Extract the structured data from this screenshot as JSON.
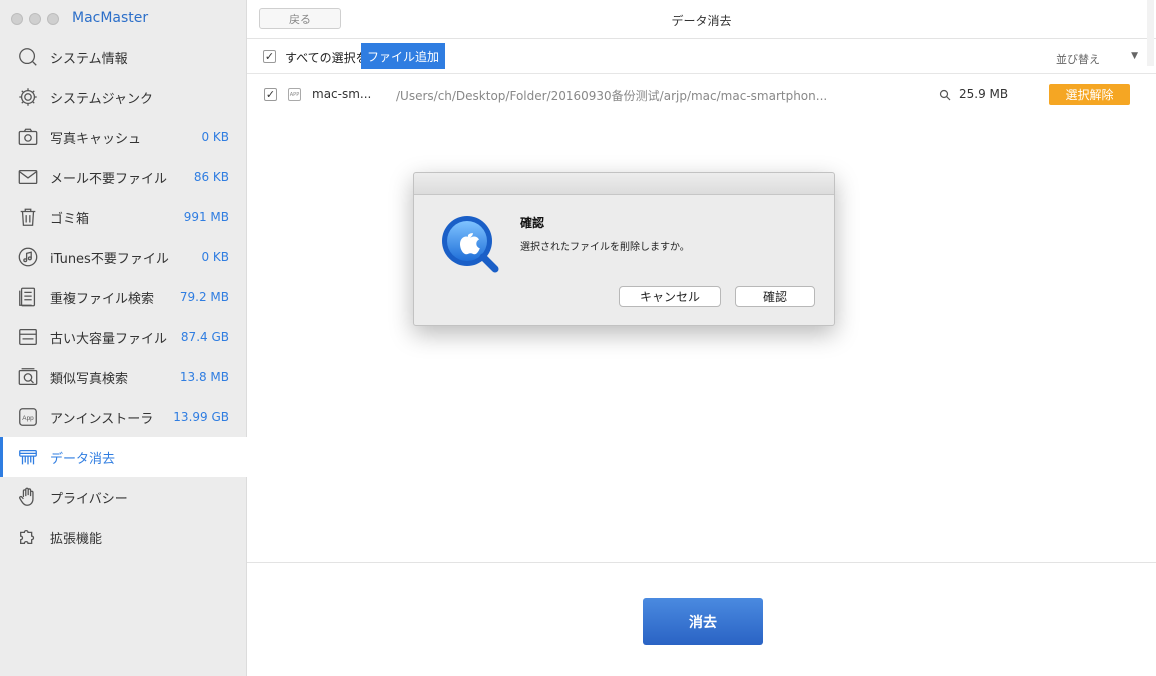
{
  "app": {
    "title": "MacMaster"
  },
  "sidebar": {
    "items": [
      {
        "label": "システム情報",
        "size": "",
        "icon": "search-icon"
      },
      {
        "label": "システムジャンク",
        "size": "",
        "icon": "gear-icon"
      },
      {
        "label": "写真キャッシュ",
        "size": "0 KB",
        "icon": "camera-icon"
      },
      {
        "label": "メール不要ファイル",
        "size": "86 KB",
        "icon": "mail-icon"
      },
      {
        "label": "ゴミ箱",
        "size": "991 MB",
        "icon": "trash-icon"
      },
      {
        "label": "iTunes不要ファイル",
        "size": "0 KB",
        "icon": "music-icon"
      },
      {
        "label": "重複ファイル検索",
        "size": "79.2 MB",
        "icon": "duplicate-icon"
      },
      {
        "label": "古い大容量ファイル",
        "size": "87.4 GB",
        "icon": "large-file-icon"
      },
      {
        "label": "類似写真検索",
        "size": "13.8 MB",
        "icon": "similar-photo-icon"
      },
      {
        "label": "アンインストーラ",
        "size": "13.99 GB",
        "icon": "app-icon",
        "icon_text": "App"
      },
      {
        "label": "データ消去",
        "size": "",
        "icon": "shredder-icon",
        "active": true
      },
      {
        "label": "プライバシー",
        "size": "",
        "icon": "hand-icon"
      },
      {
        "label": "拡張機能",
        "size": "",
        "icon": "puzzle-icon"
      }
    ]
  },
  "header": {
    "back_label": "戻る",
    "title": "データ消去"
  },
  "listbar": {
    "select_all_label": "すべての選択を",
    "add_file_label": "ファイル追加",
    "sort_label": "並び替え"
  },
  "files": [
    {
      "name": "mac-sm...",
      "path": "/Users/ch/Desktop/Folder/20160930备份测试/arjp/mac/mac-smartphon...",
      "size": "25.9 MB",
      "action": "選択解除",
      "icon_text": "APP"
    }
  ],
  "footer": {
    "erase_label": "消去"
  },
  "dialog": {
    "title": "確認",
    "message": "選択されたファイルを削除しますか。",
    "cancel_label": "キャンセル",
    "ok_label": "確認"
  },
  "colors": {
    "accent": "#2f7de1",
    "orange": "#f5a623",
    "sidebar_bg": "#ececec"
  }
}
